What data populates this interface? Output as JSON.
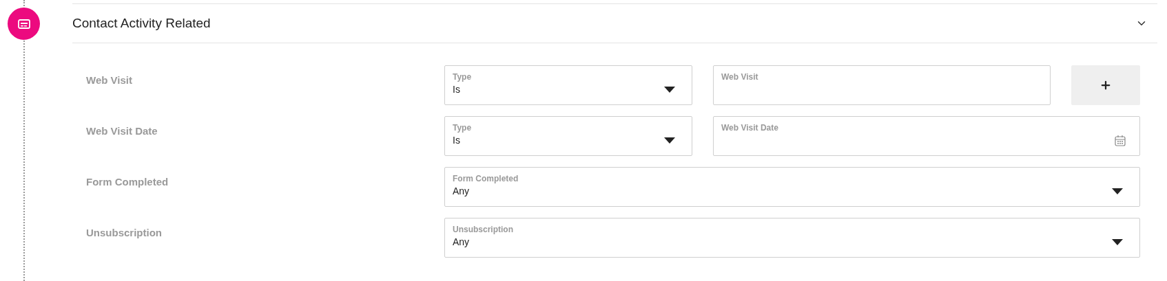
{
  "section": {
    "title": "Contact Activity Related",
    "expanded": true
  },
  "rows": [
    {
      "label": "Web Visit",
      "add_button": true,
      "fields": [
        {
          "kind": "select",
          "label": "Type",
          "value": "Is"
        },
        {
          "kind": "text",
          "label": "Web Visit"
        }
      ]
    },
    {
      "label": "Web Visit Date",
      "fields": [
        {
          "kind": "select",
          "label": "Type",
          "value": "Is"
        },
        {
          "kind": "date",
          "label": "Web Visit Date"
        }
      ]
    },
    {
      "label": "Form Completed",
      "fields": [
        {
          "kind": "select",
          "label": "Form Completed",
          "value": "Any"
        }
      ]
    },
    {
      "label": "Unsubscription",
      "fields": [
        {
          "kind": "select",
          "label": "Unsubscription",
          "value": "Any"
        }
      ]
    }
  ]
}
